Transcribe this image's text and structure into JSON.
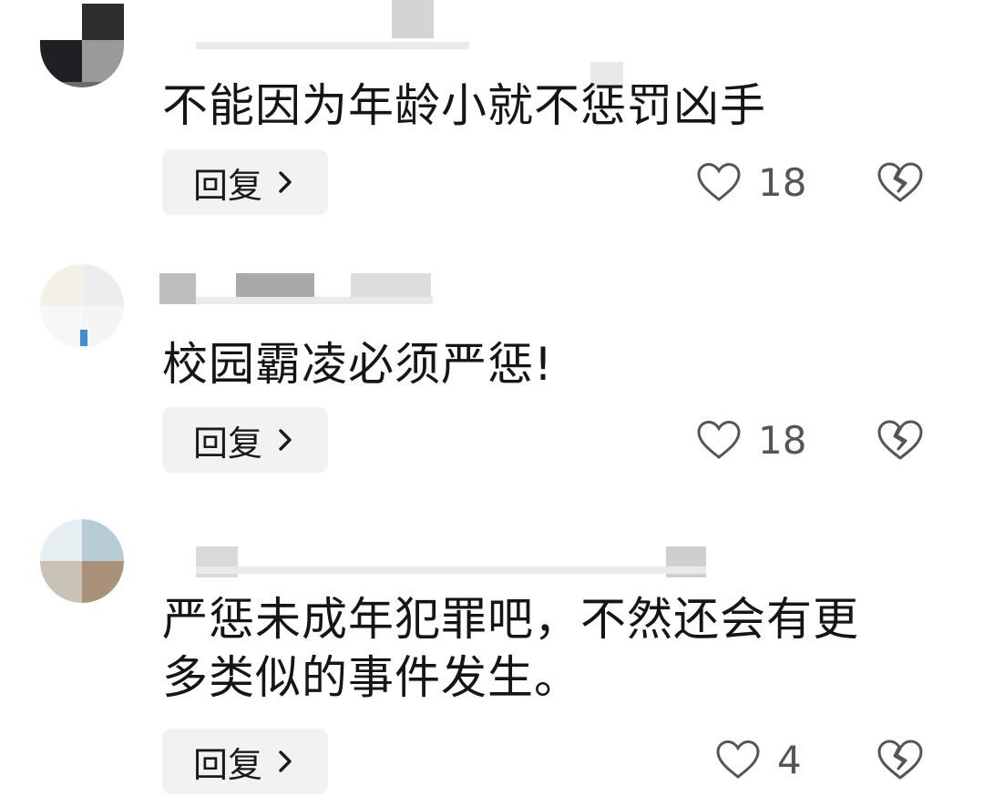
{
  "comments": [
    {
      "text": "不能因为年龄小就不惩罚凶手",
      "reply_label": "回复",
      "like_count": "18"
    },
    {
      "text": "校园霸凌必须严惩!",
      "reply_label": "回复",
      "like_count": "18"
    },
    {
      "text": "严惩未成年犯罪吧，不然还会有更\n多类似的事件发生。",
      "reply_label": "回复",
      "like_count": "4"
    }
  ],
  "icons": {
    "like": "heart-outline-icon",
    "dislike": "broken-heart-icon",
    "reply_chevron": "chevron-right-icon"
  },
  "colors": {
    "reply_bg": "#f2f2f2",
    "icon_gray": "#555555"
  }
}
